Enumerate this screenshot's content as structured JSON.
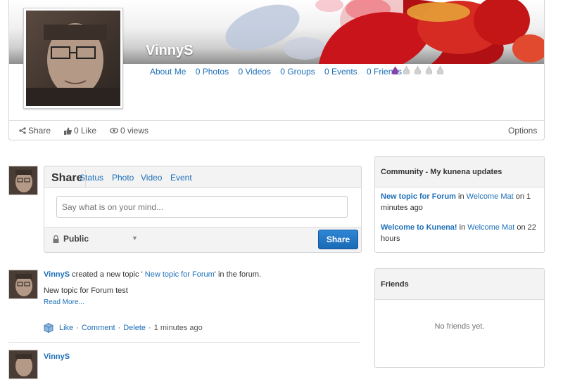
{
  "profile": {
    "username": "VinnyS",
    "links": {
      "about": "About Me",
      "photos": "0 Photos",
      "videos": "0 Videos",
      "groups": "0 Groups",
      "events": "0 Events",
      "friends": "0 Friends"
    }
  },
  "meta": {
    "share": "Share",
    "like": "0 Like",
    "views": "0 views",
    "options": "Options"
  },
  "composer": {
    "tabs": {
      "share": "Share",
      "status": "Status",
      "photo": "Photo",
      "video": "Video",
      "event": "Event"
    },
    "placeholder": "Say what is on your mind...",
    "privacy": "Public",
    "share_button": "Share"
  },
  "activity": [
    {
      "user": "VinnyS",
      "text_before": " created a new topic ' ",
      "topic": "New topic for Forum",
      "text_after": "' in the forum.",
      "body": "New topic for Forum test",
      "read_more": "Read More...",
      "like": "Like",
      "sep": "·",
      "comment": "Comment",
      "delete": "Delete",
      "time": "1 minutes ago"
    },
    {
      "user": "VinnyS"
    }
  ],
  "community": {
    "title": "Community - My kunena updates",
    "updates": [
      {
        "title": "New topic for Forum",
        "in": " in ",
        "place": "Welcome Mat",
        "on": " on 1 minutes ago"
      },
      {
        "title": "Welcome to Kunena!",
        "in": " in ",
        "place": "Welcome Mat",
        "on": " on 22 hours"
      }
    ]
  },
  "friends": {
    "title": "Friends",
    "empty": "No friends yet."
  },
  "colors": {
    "link": "#1e6fb8",
    "share_button": "#1f72c2",
    "drop_active": "#8b3fa7",
    "drop_inactive": "#c9c9c9"
  }
}
